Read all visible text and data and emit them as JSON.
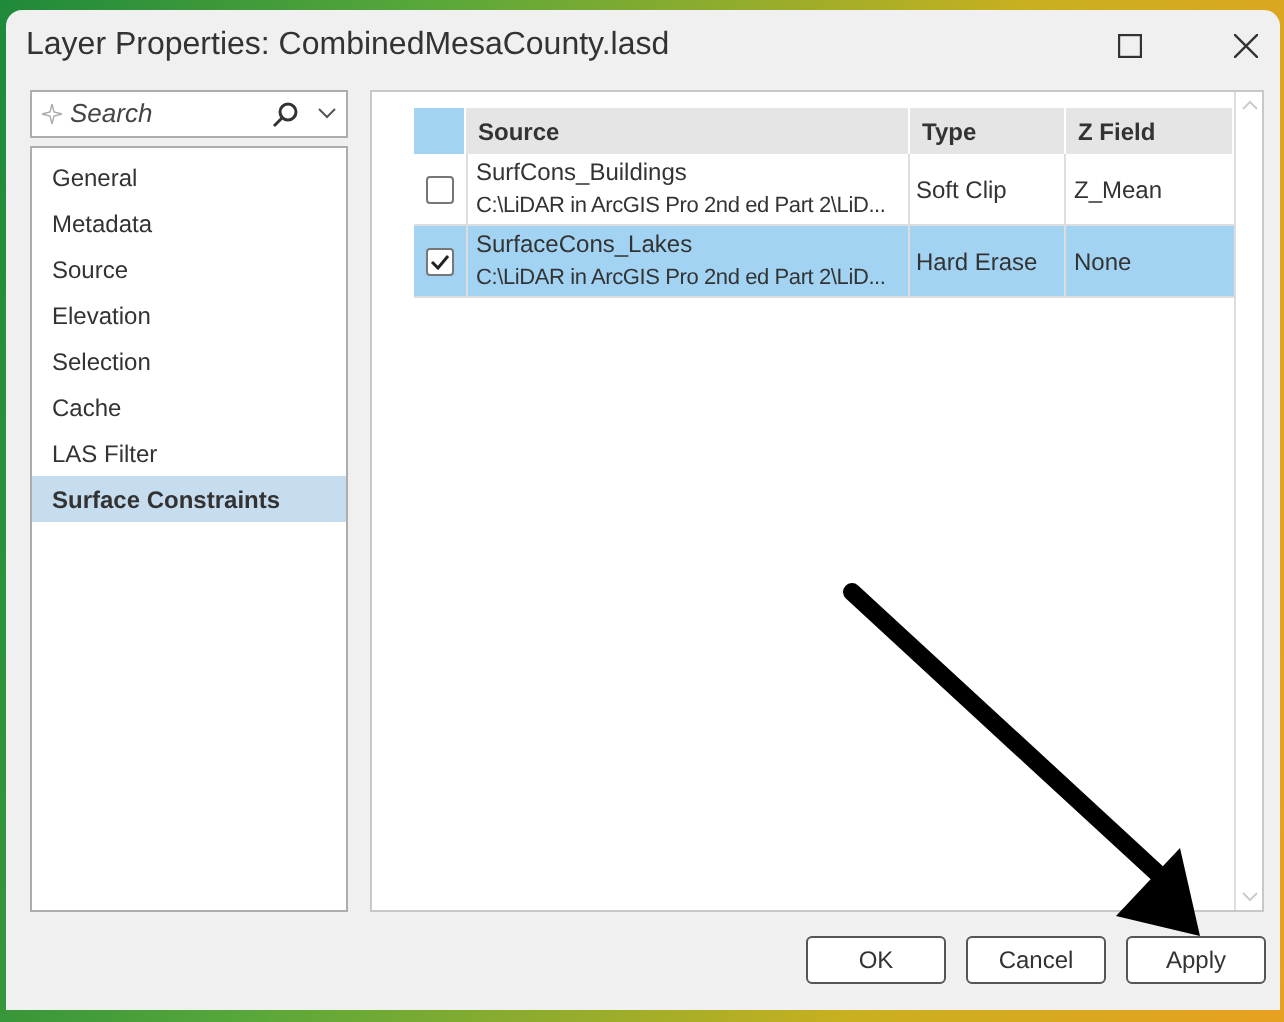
{
  "window": {
    "title": "Layer Properties: CombinedMesaCounty.lasd"
  },
  "search": {
    "placeholder": "Search"
  },
  "sidebar": {
    "items": [
      {
        "label": "General",
        "selected": false
      },
      {
        "label": "Metadata",
        "selected": false
      },
      {
        "label": "Source",
        "selected": false
      },
      {
        "label": "Elevation",
        "selected": false
      },
      {
        "label": "Selection",
        "selected": false
      },
      {
        "label": "Cache",
        "selected": false
      },
      {
        "label": "LAS Filter",
        "selected": false
      },
      {
        "label": "Surface Constraints",
        "selected": true
      }
    ]
  },
  "table": {
    "columns": [
      "Source",
      "Type",
      "Z Field"
    ],
    "rows": [
      {
        "name": "SurfCons_Buildings",
        "path": "C:\\LiDAR in ArcGIS Pro 2nd ed Part 2\\LiD...",
        "type": "Soft Clip",
        "z_field": "Z_Mean",
        "checked": false,
        "selected": false
      },
      {
        "name": "SurfaceCons_Lakes",
        "path": "C:\\LiDAR in ArcGIS Pro 2nd ed Part 2\\LiD...",
        "type": "Hard Erase",
        "z_field": "None",
        "checked": true,
        "selected": true
      }
    ]
  },
  "buttons": [
    "OK",
    "Cancel",
    "Apply"
  ]
}
